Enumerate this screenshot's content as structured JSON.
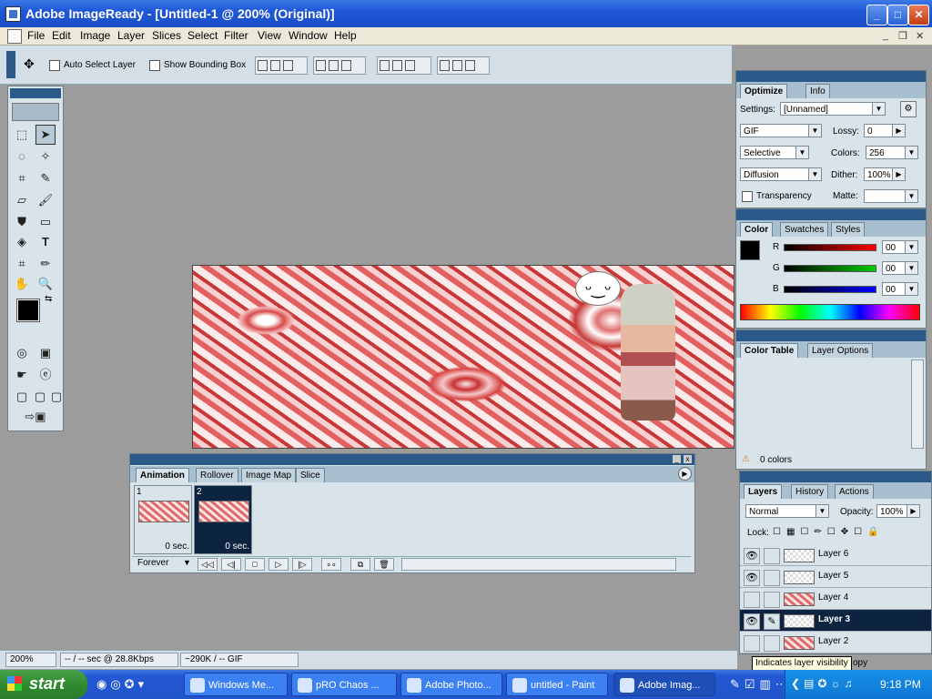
{
  "window": {
    "title": "Adobe ImageReady - [Untitled-1 @ 200% (Original)]",
    "min": "_",
    "max": "□",
    "close": "✕"
  },
  "menu": [
    "File",
    "Edit",
    "Image",
    "Layer",
    "Slices",
    "Select",
    "Filter",
    "View",
    "Window",
    "Help"
  ],
  "mdi": {
    "min": "_",
    "restore": "❐",
    "close": "✕"
  },
  "options": {
    "auto_select": "Auto Select Layer",
    "show_bounding": "Show Bounding Box"
  },
  "optimize": {
    "tabs": [
      "Optimize",
      "Info"
    ],
    "settings_label": "Settings:",
    "settings_value": "[Unnamed]",
    "format": "GIF",
    "lossy_label": "Lossy:",
    "lossy_value": "0",
    "reduction": "Selective",
    "colors_label": "Colors:",
    "colors_value": "256",
    "dither_algo": "Diffusion",
    "dither_label": "Dither:",
    "dither_value": "100%",
    "transparency": "Transparency",
    "matte_label": "Matte:"
  },
  "color": {
    "tabs": [
      "Color",
      "Swatches",
      "Styles"
    ],
    "r_label": "R",
    "g_label": "G",
    "b_label": "B",
    "r": "00",
    "g": "00",
    "b": "00"
  },
  "colortable": {
    "tabs": [
      "Color Table",
      "Layer Options"
    ],
    "count": "0 colors"
  },
  "layers": {
    "tabs": [
      "Layers",
      "History",
      "Actions"
    ],
    "blend": "Normal",
    "opacity_label": "Opacity:",
    "opacity": "100%",
    "lock_label": "Lock:",
    "items": [
      {
        "name": "Layer 6",
        "visible": "👁",
        "link": ""
      },
      {
        "name": "Layer 5",
        "visible": "👁",
        "link": ""
      },
      {
        "name": "Layer 4",
        "visible": "",
        "link": ""
      },
      {
        "name": "Layer 3",
        "visible": "👁",
        "link": "✎"
      },
      {
        "name": "Layer 2",
        "visible": "",
        "link": ""
      },
      {
        "name": "opy",
        "visible": "",
        "link": ""
      }
    ]
  },
  "tooltip": "Indicates layer visibility",
  "animation": {
    "tabs": [
      "Animation",
      "Rollover",
      "Image Map",
      "Slice"
    ],
    "frames": [
      {
        "num": "1",
        "delay": "0 sec."
      },
      {
        "num": "2",
        "delay": "0 sec."
      }
    ],
    "loop": "Forever"
  },
  "status": {
    "zoom": "200%",
    "download": "-- / -- sec @ 28.8Kbps",
    "size": "~290K / -- GIF"
  },
  "taskbar": {
    "start": "start",
    "tasks": [
      "Windows Me...",
      "pRO Chaos ...",
      "Adobe Photo...",
      "untitled - Paint",
      "Adobe Imag..."
    ],
    "clock": "9:18 PM"
  },
  "canvas": {
    "bubble": "ᵕ‿ᵕ"
  },
  "colors": {
    "title": "#1f57d6",
    "panel": "#d8e3ea",
    "palhdr": "#2b5a8a",
    "selected": "#0c2440"
  }
}
